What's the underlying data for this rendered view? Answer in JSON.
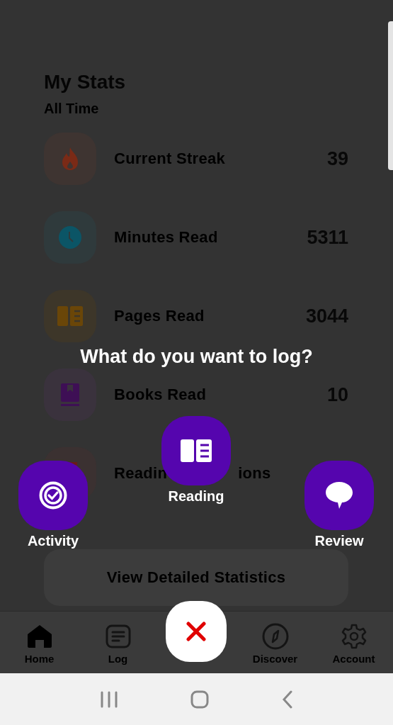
{
  "stats": {
    "title": "My Stats",
    "period": "All Time",
    "items": [
      {
        "label": "Current Streak",
        "value": "39",
        "color": "#7a2a16"
      },
      {
        "label": "Minutes Read",
        "value": "5311",
        "color": "#0b5566"
      },
      {
        "label": "Pages Read",
        "value": "3044",
        "color": "#6a4608"
      },
      {
        "label": "Books Read",
        "value": "10",
        "color": "#3e0f55"
      },
      {
        "label": "Readin",
        "label_tail": "ions",
        "color": "#6a1a1a"
      }
    ],
    "details_button": "View Detailed Statistics"
  },
  "bottom_nav": [
    {
      "label": "Home",
      "selected": true
    },
    {
      "label": "Log",
      "selected": false
    },
    {
      "label": "Discover",
      "selected": false
    },
    {
      "label": "Account",
      "selected": false
    }
  ],
  "log_menu": {
    "title": "What do you want to log?",
    "options": [
      {
        "label": "Activity"
      },
      {
        "label": "Reading"
      },
      {
        "label": "Review"
      }
    ]
  }
}
